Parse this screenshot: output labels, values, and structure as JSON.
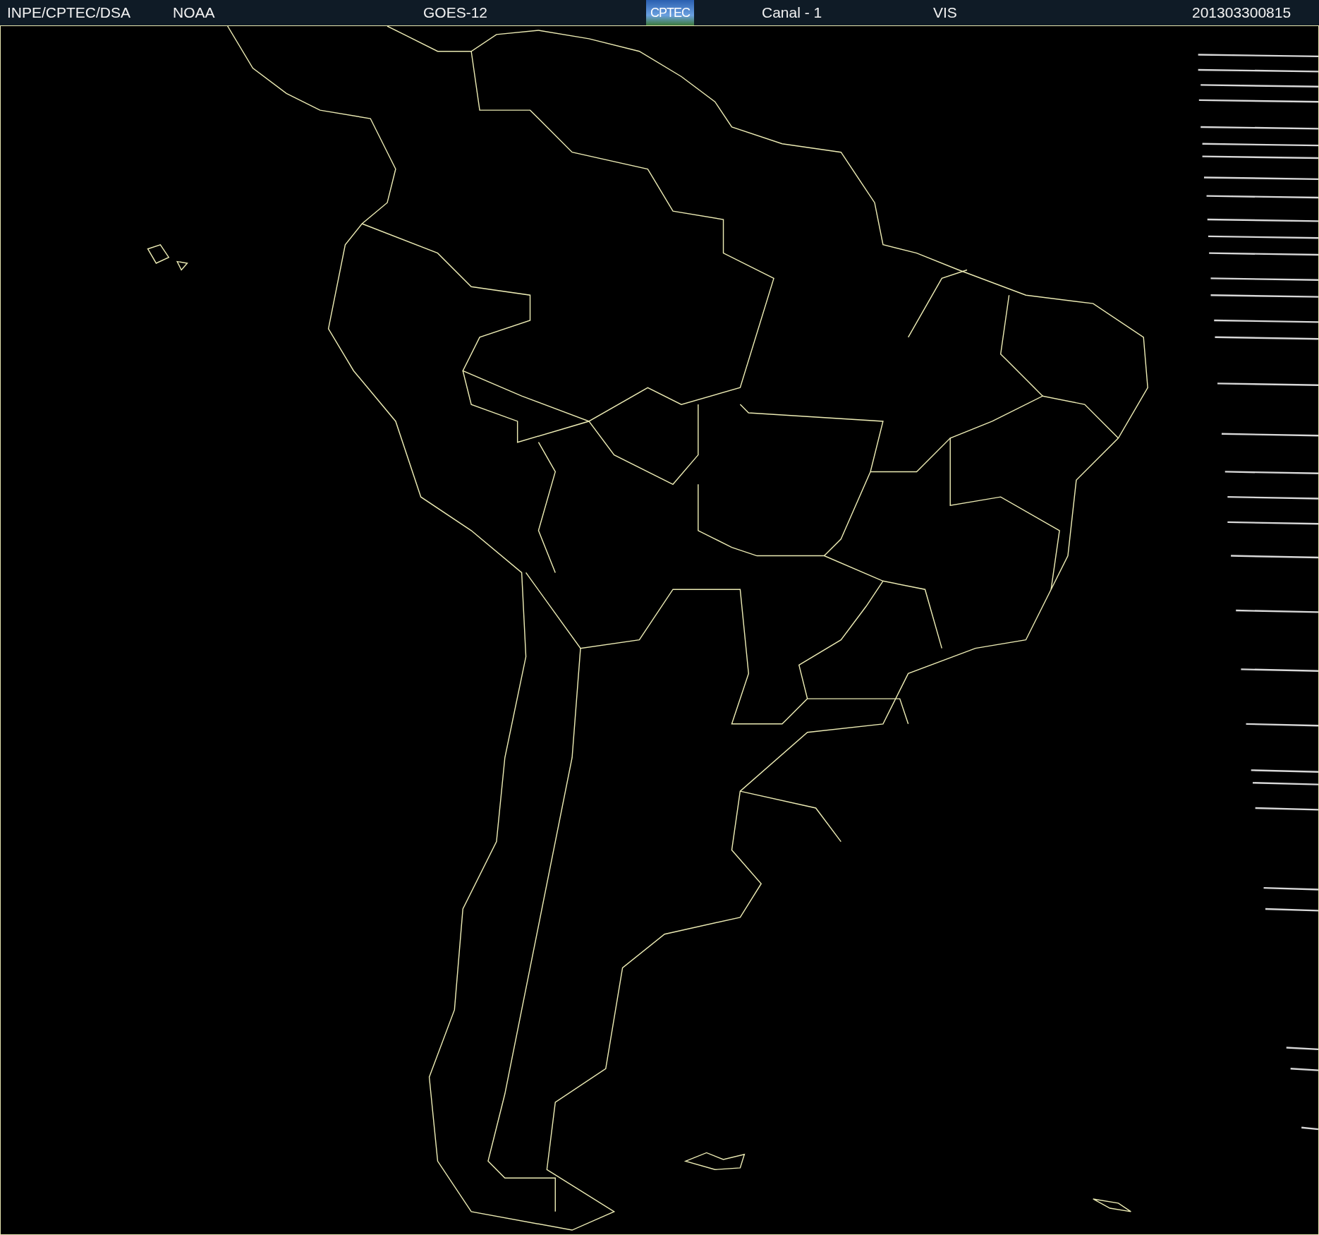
{
  "header": {
    "source": "INPE/CPTEC/DSA",
    "agency": "NOAA",
    "satellite": "GOES-12",
    "logo_text": "CPTEC",
    "channel": "Canal - 1",
    "band": "VIS",
    "timestamp": "201303300815"
  }
}
